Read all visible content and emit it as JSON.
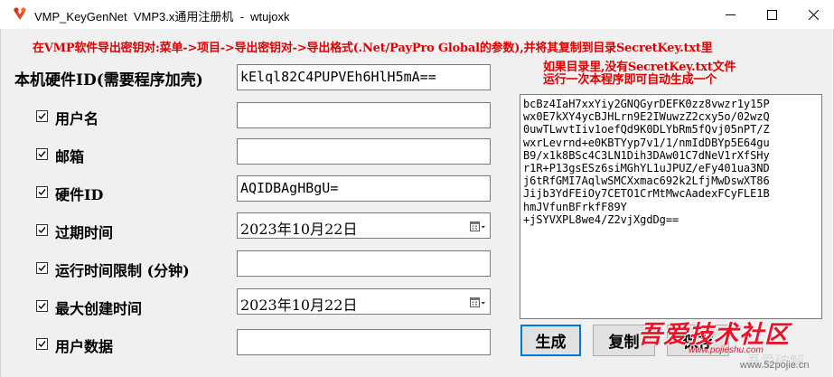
{
  "window": {
    "title": "VMP_KeyGenNet  VMP3.x通用注册机  -  wtujoxk",
    "minimize_icon": "minimize-icon",
    "maximize_icon": "maximize-icon",
    "close_icon": "close-icon"
  },
  "notice": {
    "line1": "在VMP软件导出密钥对:菜单->项目->导出密钥对->导出格式(.Net/PayPro Global的参数),并将其复制到目录SecretKey.txt里",
    "line2": "如果目录里,没有SecretKey.txt文件",
    "line3": "运行一次本程序即可自动生成一个",
    "color": "#e00000"
  },
  "hardware": {
    "label": "本机硬件ID(需要程序加壳)",
    "value": "kElql82C4PUPVEh6HlH5mA=="
  },
  "fields": {
    "username": {
      "label": "用户名",
      "checked": true,
      "value": ""
    },
    "email": {
      "label": "邮箱",
      "checked": true,
      "value": ""
    },
    "hwid": {
      "label": "硬件ID",
      "checked": true,
      "value": "AQIDBAgHBgU="
    },
    "expiry": {
      "label": "过期时间",
      "checked": true,
      "value": "2023年10月22日"
    },
    "runtime": {
      "label": "运行时间限制 (分钟)",
      "checked": true,
      "value": ""
    },
    "maxbuild": {
      "label": "最大创建时间",
      "checked": true,
      "value": "2023年10月22日"
    },
    "userdata": {
      "label": "用户数据",
      "checked": true,
      "value": ""
    }
  },
  "serial_output": "bcBz4IaH7xxYiy2GNQGyrDEFK0zz8vwzr1y15P\nwx0E7kXY4ycBJHLrn9E2IWuwzZ2cxy5o/02wzQ\n0uwTLwvtIiv1oefQd9K0DLYbRm5fQvj05nPT/Z\nwxrLevrnd+e0KBTYyp7v1/1/nmIdDBYp5E64gu\nB9/x1k8BSc4C3LN1Dih3DAw01C7dNeV1rXfSHy\nr1R+P13gsESz6siMGhYL1uJPUZ/eFy401ua3ND\nj6tRfGMI7AqlwSMCXxmac692k2LfjMwDswXT86\nJijb3YdFEiOy7CETO1CrMtMwcAadexFCyFLE1B\nhmJVfunBFrkfF89Y\n+jSYVXPL8we4/Z2vjXgdDg==",
  "buttons": {
    "generate": "生成",
    "copy": "复制",
    "save": "保存"
  },
  "watermark": {
    "chinese": "吾爱技术社区",
    "url1": "www.pojieshu.com",
    "url2": "www.52pojie.cn"
  }
}
